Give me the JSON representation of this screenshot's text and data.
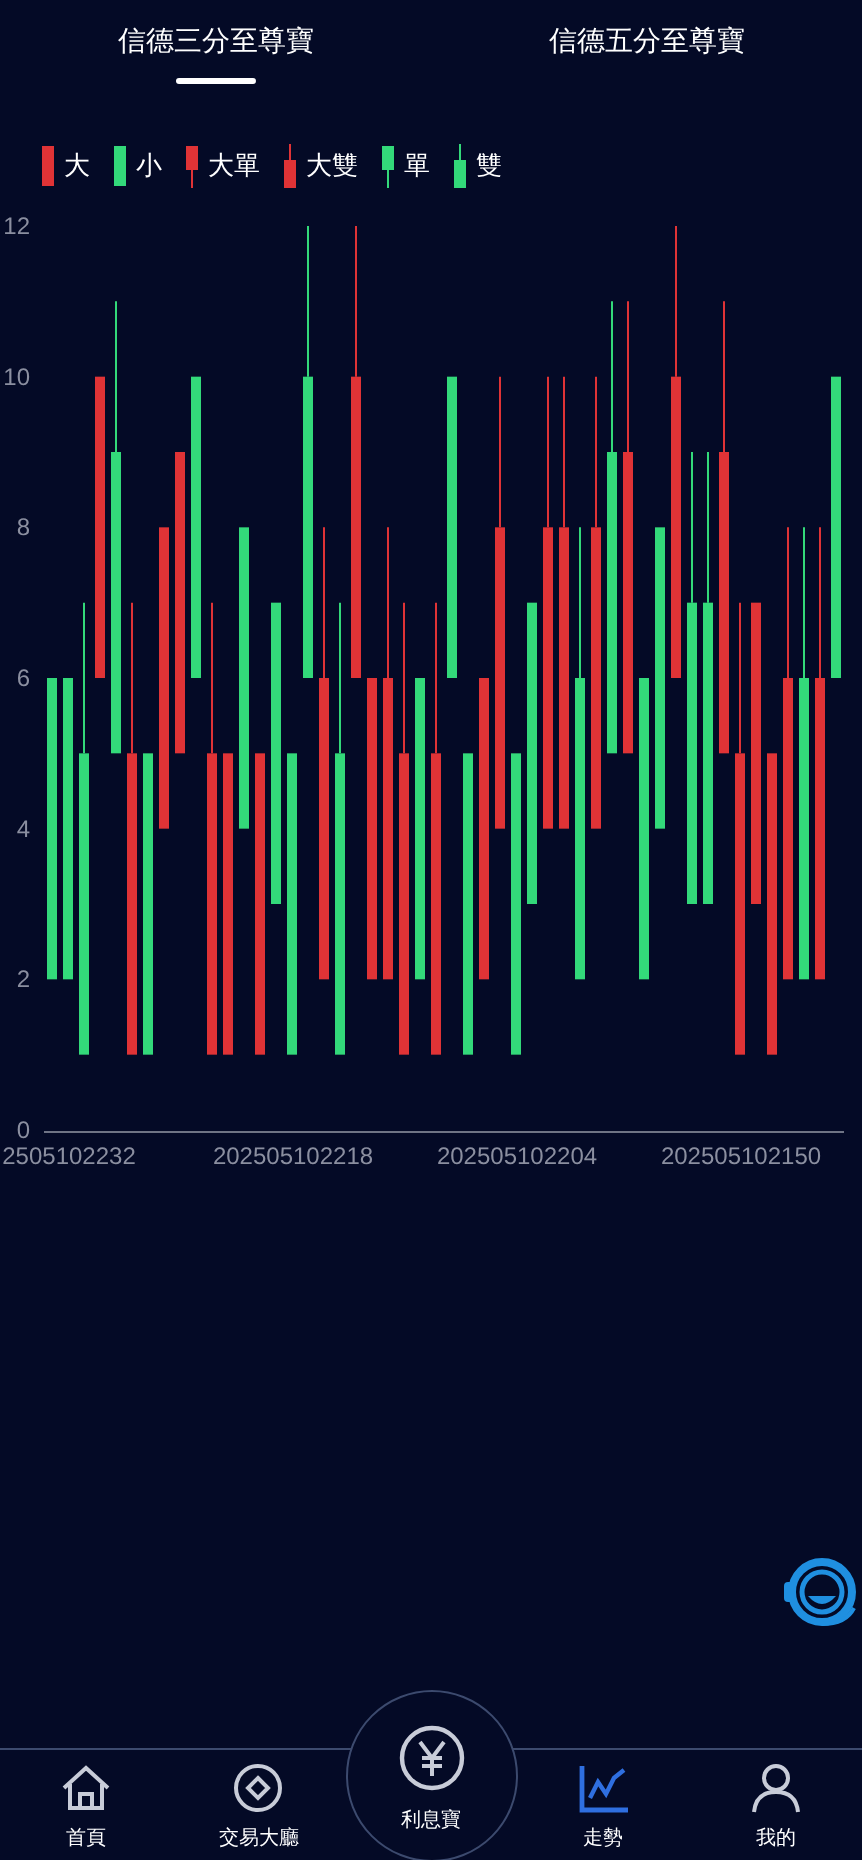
{
  "tabs": [
    {
      "label": "信德三分至尊寶",
      "selected": true
    },
    {
      "label": "信德五分至尊寶",
      "selected": false
    }
  ],
  "legend": [
    {
      "label": "大",
      "color": "#e03336",
      "kind": "plain"
    },
    {
      "label": "小",
      "color": "#33d97a",
      "kind": "plain"
    },
    {
      "label": "大單",
      "color": "#e03336",
      "kind": "wick_below"
    },
    {
      "label": "大雙",
      "color": "#e03336",
      "kind": "wick_above"
    },
    {
      "label": "單",
      "color": "#33d97a",
      "kind": "wick_below"
    },
    {
      "label": "雙",
      "color": "#33d97a",
      "kind": "wick_above"
    }
  ],
  "chart_data": {
    "type": "candlestick",
    "ylim": [
      0,
      12
    ],
    "yticks": [
      0,
      2,
      4,
      6,
      8,
      10,
      12
    ],
    "categories": [
      null,
      "2505102232",
      null,
      null,
      null,
      null,
      null,
      null,
      null,
      null,
      null,
      null,
      null,
      null,
      null,
      "202505102218",
      null,
      null,
      null,
      null,
      null,
      null,
      null,
      null,
      null,
      null,
      null,
      null,
      null,
      "202505102204",
      null,
      null,
      null,
      null,
      null,
      null,
      null,
      null,
      null,
      null,
      null,
      null,
      null,
      "202505102150",
      null,
      null,
      null,
      null,
      null,
      null
    ],
    "ohlc": [
      [
        6,
        6,
        2,
        2
      ],
      [
        6,
        6,
        2,
        2
      ],
      [
        5,
        7,
        1,
        1
      ],
      [
        6,
        10,
        6,
        10
      ],
      [
        9,
        11,
        5,
        5
      ],
      [
        1,
        7,
        1,
        5
      ],
      [
        5,
        5,
        1,
        1
      ],
      [
        4,
        8,
        4,
        8
      ],
      [
        5,
        9,
        5,
        9
      ],
      [
        10,
        10,
        6,
        6
      ],
      [
        1,
        7,
        1,
        5
      ],
      [
        1,
        5,
        1,
        5
      ],
      [
        8,
        8,
        4,
        4
      ],
      [
        1,
        5,
        1,
        5
      ],
      [
        7,
        7,
        3,
        3
      ],
      [
        5,
        5,
        1,
        1
      ],
      [
        10,
        12,
        6,
        6
      ],
      [
        2,
        8,
        2,
        6
      ],
      [
        5,
        7,
        1,
        1
      ],
      [
        6,
        12,
        6,
        10
      ],
      [
        2,
        6,
        2,
        6
      ],
      [
        2,
        8,
        2,
        6
      ],
      [
        1,
        7,
        1,
        5
      ],
      [
        6,
        6,
        2,
        2
      ],
      [
        1,
        7,
        1,
        5
      ],
      [
        10,
        10,
        6,
        6
      ],
      [
        5,
        5,
        1,
        1
      ],
      [
        2,
        6,
        2,
        6
      ],
      [
        4,
        10,
        4,
        8
      ],
      [
        5,
        5,
        1,
        1
      ],
      [
        7,
        7,
        3,
        3
      ],
      [
        4,
        10,
        4,
        8
      ],
      [
        4,
        10,
        4,
        8
      ],
      [
        6,
        8,
        2,
        2
      ],
      [
        4,
        10,
        4,
        8
      ],
      [
        9,
        11,
        5,
        5
      ],
      [
        5,
        11,
        5,
        9
      ],
      [
        6,
        6,
        2,
        2
      ],
      [
        8,
        8,
        4,
        4
      ],
      [
        6,
        12,
        6,
        10
      ],
      [
        7,
        9,
        3,
        3
      ],
      [
        7,
        9,
        3,
        3
      ],
      [
        5,
        11,
        5,
        9
      ],
      [
        1,
        7,
        1,
        5
      ],
      [
        3,
        7,
        3,
        7
      ],
      [
        1,
        5,
        1,
        5
      ],
      [
        2,
        8,
        2,
        6
      ],
      [
        6,
        8,
        2,
        2
      ],
      [
        2,
        8,
        2,
        6
      ],
      [
        10,
        10,
        6,
        6
      ]
    ]
  },
  "nav": [
    {
      "label": "首頁",
      "kind": "normal",
      "selected": false
    },
    {
      "label": "交易大廳",
      "kind": "normal",
      "selected": false
    },
    {
      "label": "利息寶",
      "kind": "center",
      "selected": false
    },
    {
      "label": "走勢",
      "kind": "normal",
      "selected": true
    },
    {
      "label": "我的",
      "kind": "normal",
      "selected": false
    }
  ]
}
